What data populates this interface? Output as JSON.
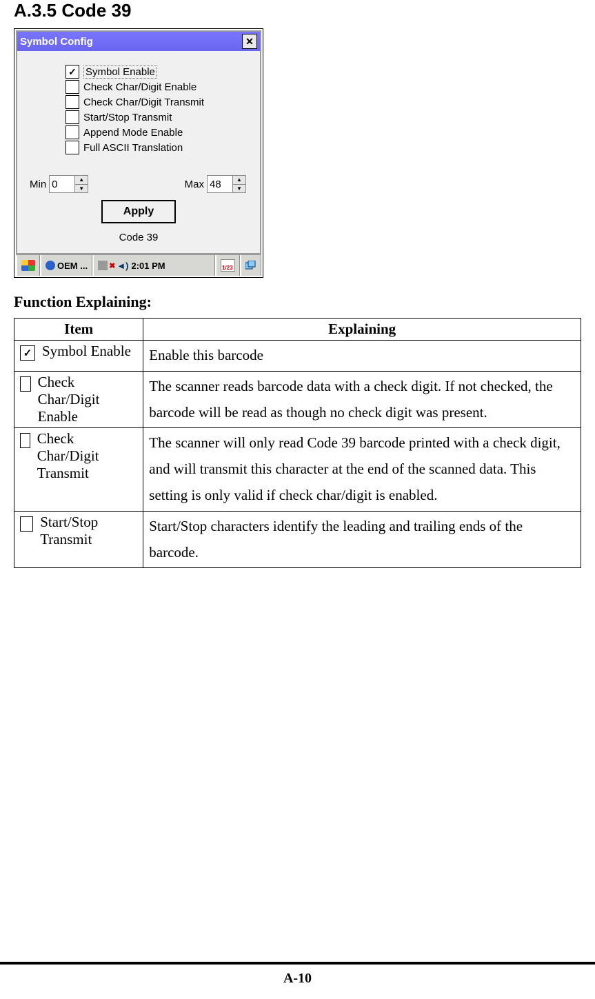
{
  "section_title": "A.3.5 Code 39",
  "dialog": {
    "title": "Symbol Config",
    "options": [
      {
        "label": "Symbol Enable",
        "checked": true
      },
      {
        "label": "Check Char/Digit Enable",
        "checked": false
      },
      {
        "label": "Check Char/Digit Transmit",
        "checked": false
      },
      {
        "label": "Start/Stop Transmit",
        "checked": false
      },
      {
        "label": "Append Mode Enable",
        "checked": false
      },
      {
        "label": "Full ASCII Translation",
        "checked": false
      }
    ],
    "min_label": "Min",
    "min_value": "0",
    "max_label": "Max",
    "max_value": "48",
    "apply_label": "Apply",
    "footer_label": "Code 39"
  },
  "taskbar": {
    "app_label": "OEM ...",
    "time": "2:01 PM",
    "cal_text": "1/23"
  },
  "function_heading": "Function Explaining:",
  "table": {
    "headers": [
      "Item",
      "Explaining"
    ],
    "rows": [
      {
        "checked": true,
        "item": "Symbol Enable",
        "explain": "Enable this barcode"
      },
      {
        "checked": false,
        "item": "Check Char/Digit Enable",
        "explain": "The scanner reads barcode data with a check digit. If not checked, the barcode will be read as though no check digit was present."
      },
      {
        "checked": false,
        "item": "Check Char/Digit Transmit",
        "explain": "The scanner will only read Code 39 barcode printed with a check digit, and will transmit this character at the end of the scanned data. This setting is only valid if check char/digit is enabled."
      },
      {
        "checked": false,
        "item": "Start/Stop Transmit",
        "explain": "Start/Stop characters identify the leading and trailing ends of the barcode."
      }
    ]
  },
  "page_number": "A-10"
}
